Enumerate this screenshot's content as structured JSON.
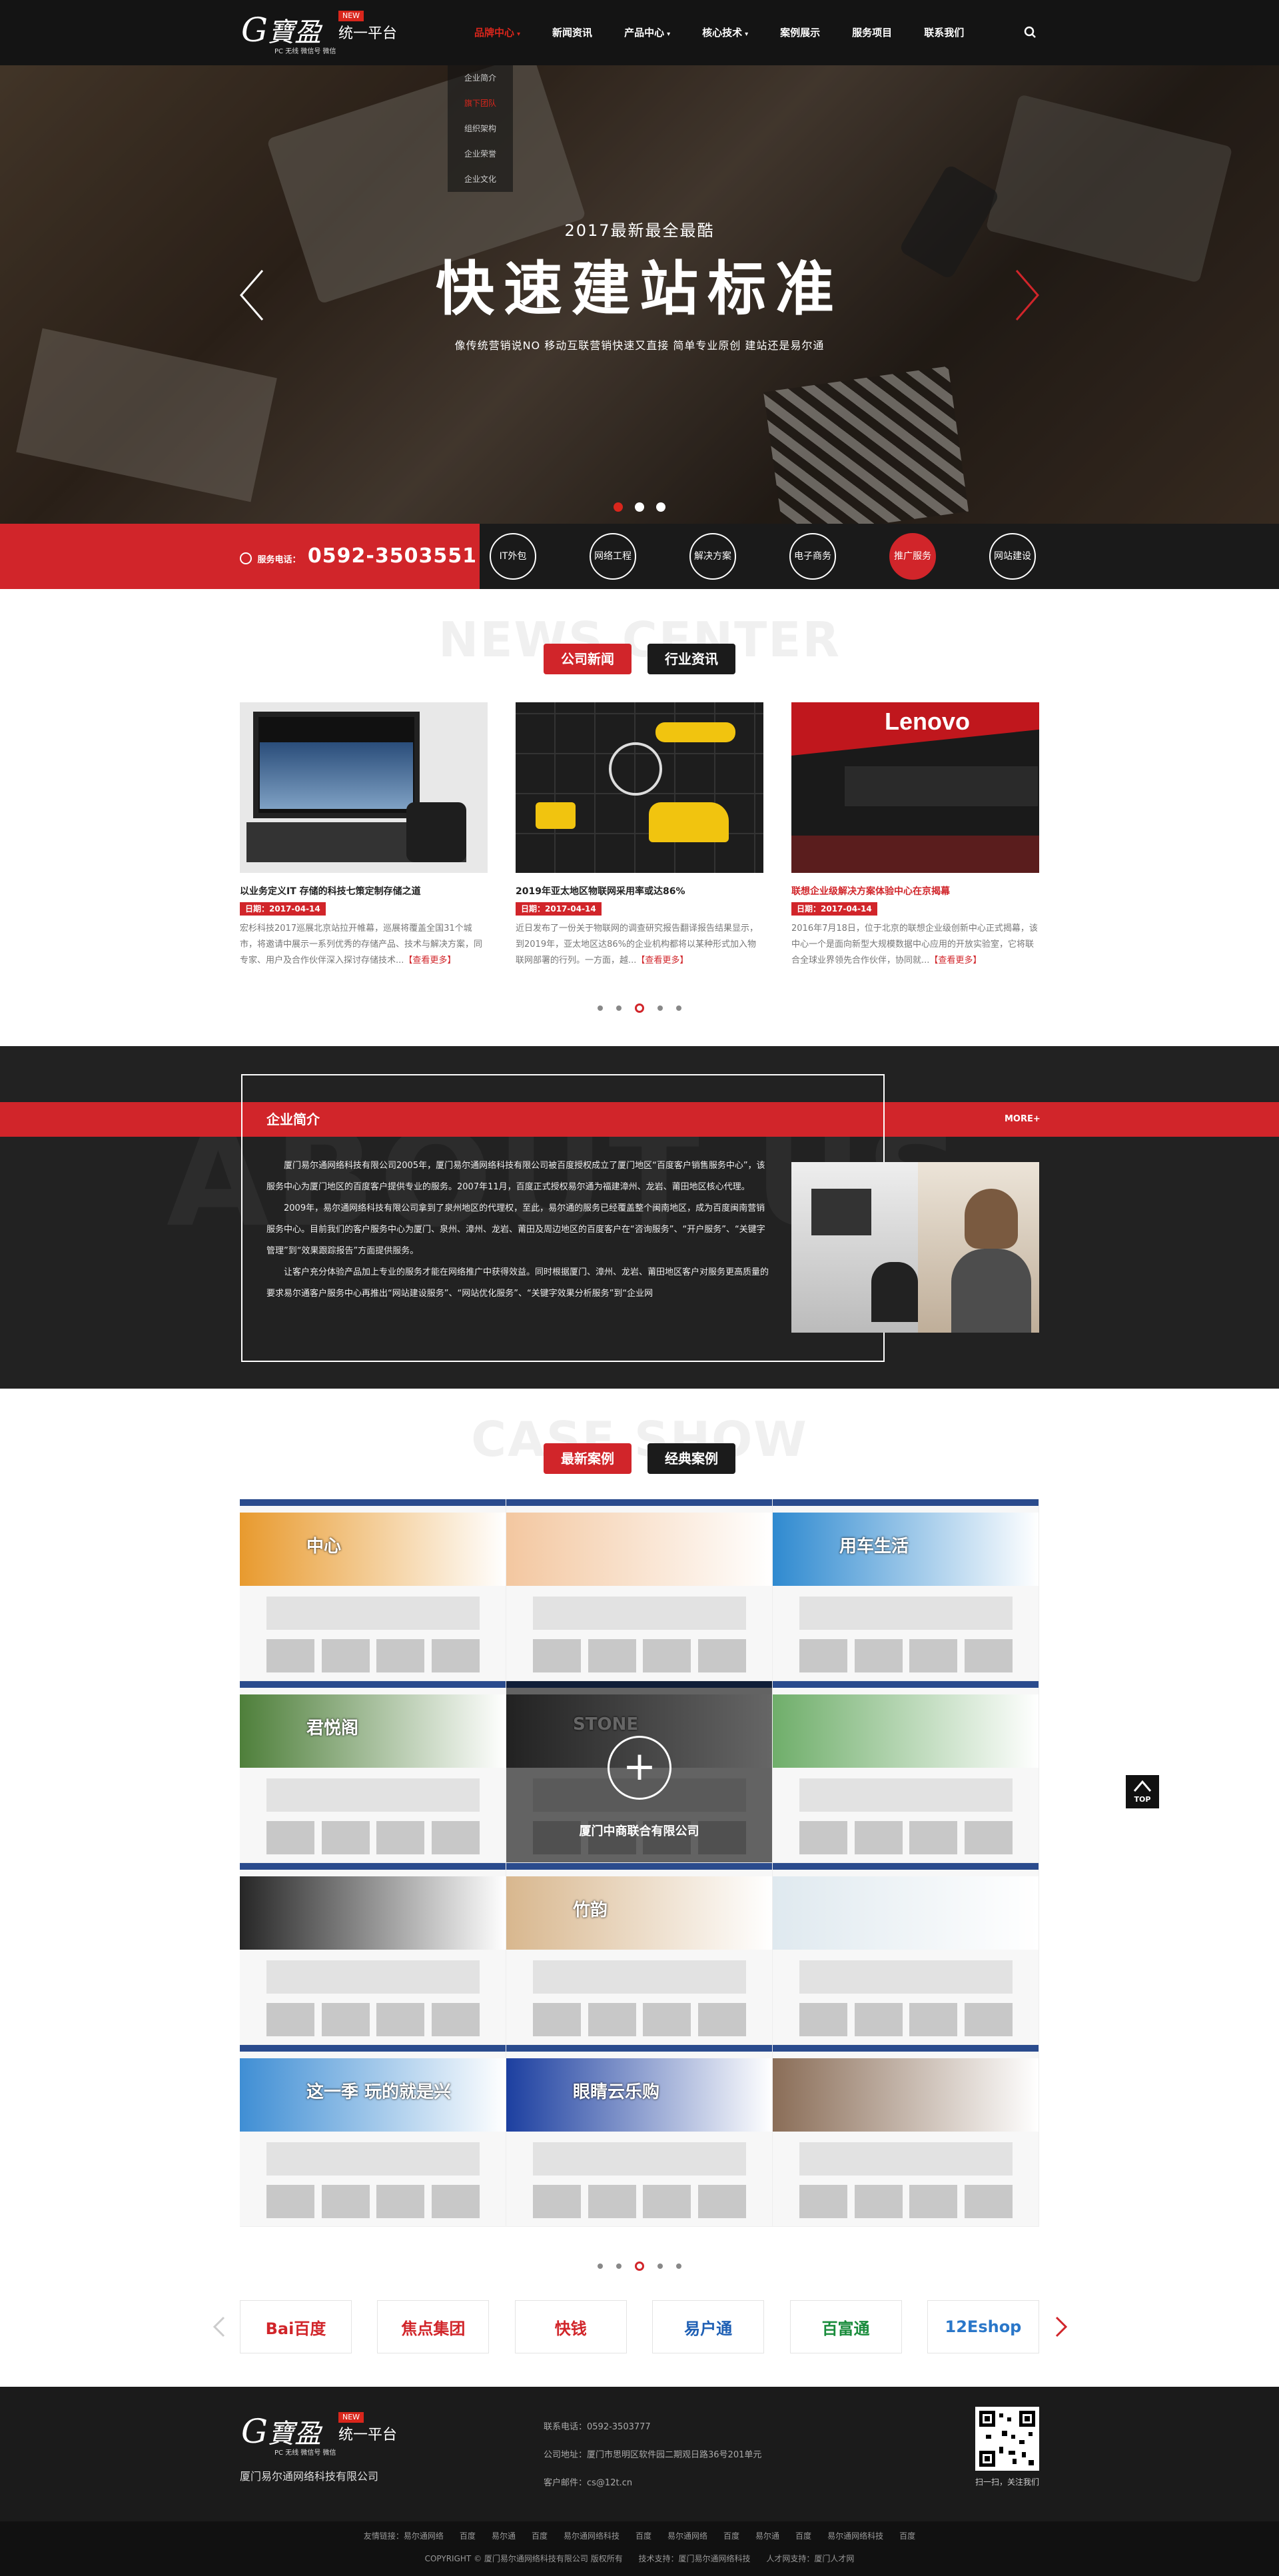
{
  "logo": {
    "script": "G",
    "cn": "寶盈",
    "new_badge": "NEW",
    "title": "统一平台",
    "subline": "PC 无线 微信号 微信"
  },
  "nav": {
    "items": [
      {
        "label": "品牌中心",
        "caret": "▾"
      },
      {
        "label": "新闻资讯",
        "caret": ""
      },
      {
        "label": "产品中心",
        "caret": "▾"
      },
      {
        "label": "核心技术",
        "caret": "▾"
      },
      {
        "label": "案例展示",
        "caret": ""
      },
      {
        "label": "服务项目",
        "caret": ""
      },
      {
        "label": "联系我们",
        "caret": ""
      }
    ],
    "dropdown": [
      "企业简介",
      "旗下团队",
      "组织架构",
      "企业荣誉",
      "企业文化"
    ]
  },
  "banner": {
    "subtitle": "2017最新最全最酷",
    "title": "快速建站标准",
    "desc": "像传统营销说NO 移动互联营销快速又直接 简单专业原创 建站还是易尔通"
  },
  "hotline": {
    "label": "服务电话：",
    "number": "0592-3503551"
  },
  "services": [
    "IT外包",
    "网络工程",
    "解决方案",
    "电子商务",
    "推广服务",
    "网站建设"
  ],
  "news": {
    "bg_title": "NEWS CENTER",
    "tabs": [
      "公司新闻",
      "行业资讯"
    ],
    "items": [
      {
        "title": "以业务定义IT 存储的科技七策定制存储之道",
        "date": "日期：2017-04-14",
        "summary": "宏杉科技2017巡展北京站拉开帷幕，巡展将覆盖全国31个城市，将邀请中展示一系列优秀的存储产品、技术与解决方案，同专家、用户及合作伙伴深入探讨存储技术...",
        "more": "【查看更多】"
      },
      {
        "title": "2019年亚太地区物联网采用率或达86%",
        "date": "日期：2017-04-14",
        "summary": "近日发布了一份关于物联网的调查研究报告翻译报告结果显示，到2019年，亚太地区达86%的企业机构都将以某种形式加入物联网部署的行列。一方面，越...",
        "more": "【查看更多】"
      },
      {
        "title": "联想企业级解决方案体验中心在京揭幕",
        "date": "日期：2017-04-14",
        "summary": "2016年7月18日，位于北京的联想企业级创新中心正式揭幕，该中心一个是面向新型大规模数据中心应用的开放实验室，它将联合全球业界领先合作伙伴，协同就...",
        "more": "【查看更多】"
      }
    ]
  },
  "about": {
    "bg_word": "ABOUT US",
    "title": "企业简介",
    "more": "MORE+",
    "paragraphs": [
      "厦门易尔通网络科技有限公司2005年，厦门易尔通网络科技有限公司被百度授权成立了厦门地区“百度客户销售服务中心”，该服务中心为厦门地区的百度客户提供专业的服务。2007年11月，百度正式授权易尔通为福建漳州、龙岩、莆田地区核心代理。",
      "2009年，易尔通网络科技有限公司拿到了泉州地区的代理权，至此，易尔通的服务已经覆盖整个闽南地区，成为百度闽南营销服务中心。目前我们的客户服务中心为厦门、泉州、漳州、龙岩、莆田及周边地区的百度客户在“咨询服务”、“开户服务”、“关键字管理”到“效果跟踪报告”方面提供服务。",
      "让客户充分体验产品加上专业的服务才能在网络推广中获得效益。同时根据厦门、漳州、龙岩、莆田地区客户对服务更高质量的要求易尔通客户服务中心再推出“网站建设服务”、“网站优化服务”、“关键字效果分析服务”到“企业网"
    ]
  },
  "cases": {
    "bg_title": "CASE SHOW",
    "tabs": [
      "最新案例",
      "经典案例"
    ],
    "hover_name": "厦门中商联合有限公司",
    "items": [
      {
        "banner": "中心",
        "accent": "#e89a2e"
      },
      {
        "banner": "",
        "accent": "#f3c7a0"
      },
      {
        "banner": "用车生活",
        "accent": "#2f8ad0"
      },
      {
        "banner": "君悦阁",
        "accent": "#4e7f3a"
      },
      {
        "banner": "STONE",
        "accent": "#555555"
      },
      {
        "banner": "",
        "accent": "#6fae6a"
      },
      {
        "banner": "",
        "accent": "#262626"
      },
      {
        "banner": "竹韵",
        "accent": "#d8b78e"
      },
      {
        "banner": "",
        "accent": "#dfe9ef"
      },
      {
        "banner": "这一季 玩的就是兴",
        "accent": "#3f8ed4"
      },
      {
        "banner": "眼睛云乐购",
        "accent": "#1c3fa0"
      },
      {
        "banner": "",
        "accent": "#8a6d57"
      }
    ]
  },
  "partners": [
    {
      "name": "Bai百度",
      "color": "#d1252a"
    },
    {
      "name": "焦点集团",
      "color": "#d1252a"
    },
    {
      "name": "快钱",
      "color": "#d1252a"
    },
    {
      "name": "易户通",
      "color": "#1e5fb4"
    },
    {
      "name": "百富通",
      "color": "#1a8c3c"
    },
    {
      "name": "12Eshop",
      "color": "#2a77c9"
    }
  ],
  "footer": {
    "company": "厦门易尔通网络科技有限公司",
    "phone": "联系电话：0592-3503777",
    "address": "公司地址：厦门市思明区软件园二期观日路36号201单元",
    "email": "客户邮件：cs@12t.cn",
    "qr_caption": "扫一扫，关注我们",
    "links": [
      "友情链接：易尔通网络",
      "百度",
      "易尔通",
      "百度",
      "易尔通网络科技",
      "百度",
      "易尔通网络",
      "百度",
      "易尔通",
      "百度",
      "易尔通网络科技",
      "百度"
    ],
    "copyright": [
      "COPYRIGHT © 厦门易尔通网络科技有限公司 版权所有",
      "技术支持：厦门易尔通网络科技",
      "人才网支持：厦门人才网"
    ]
  },
  "top_button": "TOP"
}
